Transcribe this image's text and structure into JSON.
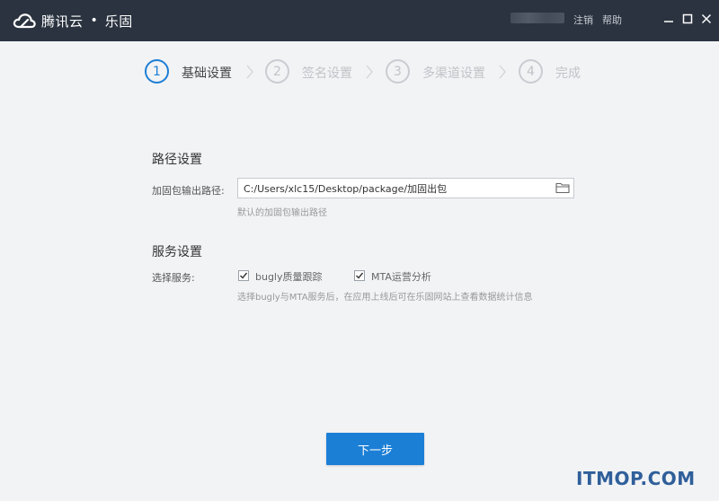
{
  "app": {
    "brand_name": "腾讯云",
    "separator": "•",
    "product_name": "乐固"
  },
  "header": {
    "logout_label": "注销",
    "help_label": "帮助"
  },
  "steps": [
    {
      "number": "1",
      "label": "基础设置",
      "active": true
    },
    {
      "number": "2",
      "label": "签名设置",
      "active": false
    },
    {
      "number": "3",
      "label": "多渠道设置",
      "active": false
    },
    {
      "number": "4",
      "label": "完成",
      "active": false
    }
  ],
  "path_section": {
    "title": "路径设置",
    "output_label": "加固包输出路径:",
    "output_value": "C:/Users/xlc15/Desktop/package/加固出包",
    "hint": "默认的加固包输出路径"
  },
  "service_section": {
    "title": "服务设置",
    "select_label": "选择服务:",
    "options": [
      {
        "label": "bugly质量跟踪",
        "checked": true
      },
      {
        "label": "MTA运营分析",
        "checked": true
      }
    ],
    "hint": "选择bugly与MTA服务后，在应用上线后可在乐固网站上查看数据统计信息"
  },
  "actions": {
    "next_label": "下一步"
  },
  "watermark": "ITMOP.COM",
  "colors": {
    "titlebar": "#2b3340",
    "accent": "#1c7fd6",
    "background": "#f2f3f5"
  }
}
